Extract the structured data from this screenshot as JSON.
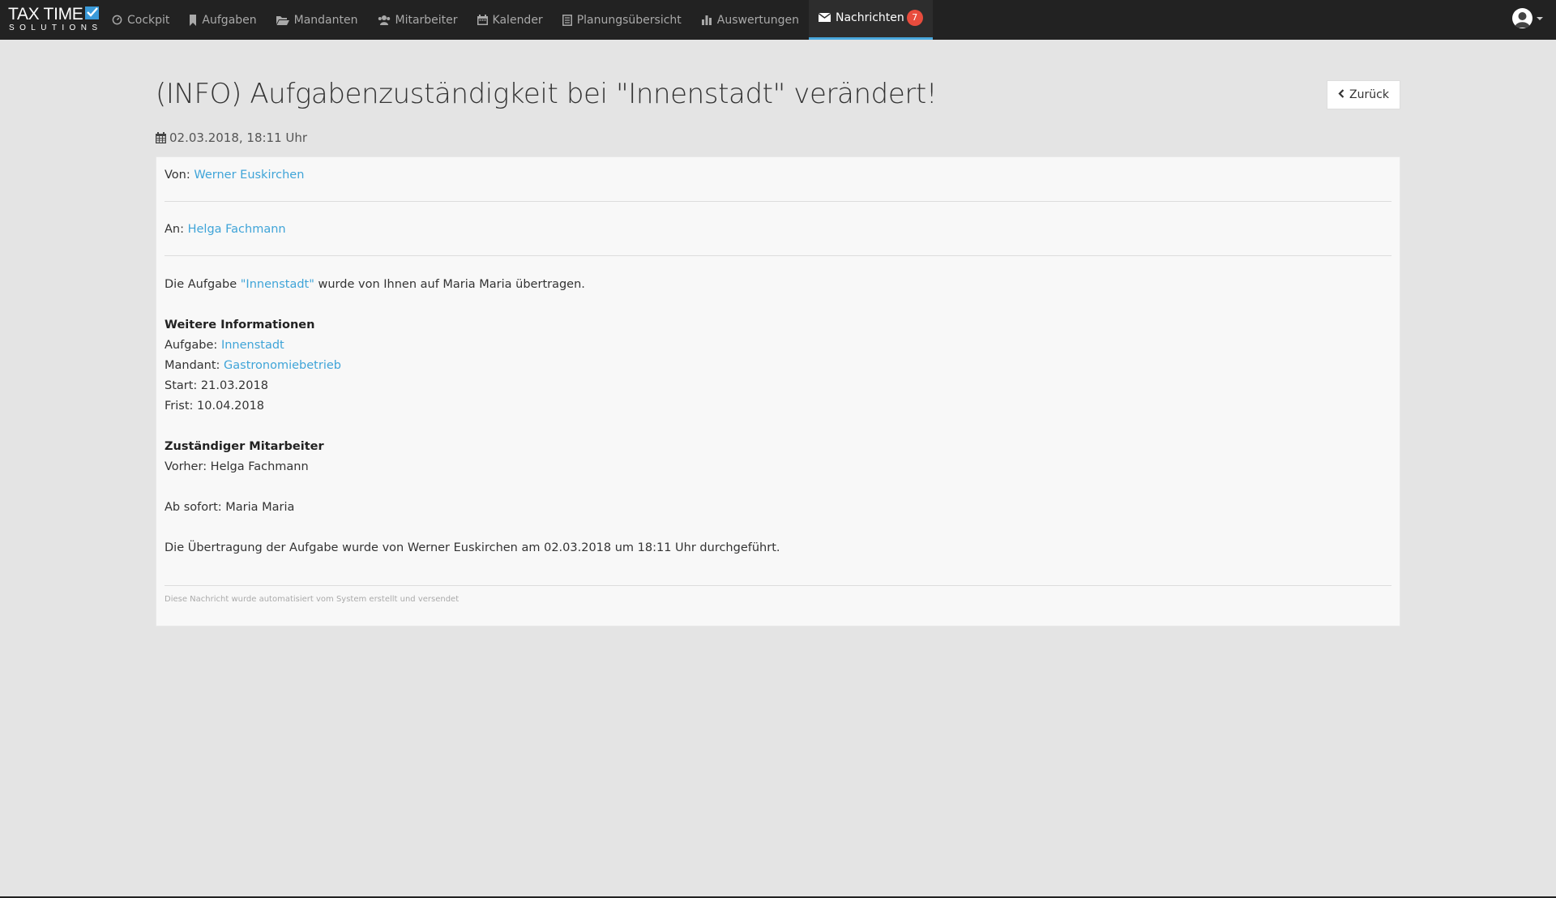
{
  "brand": {
    "line1": "TAX TIME",
    "line2": "SOLUTIONS"
  },
  "nav": [
    {
      "label": "Cockpit",
      "icon": "dashboard-icon"
    },
    {
      "label": "Aufgaben",
      "icon": "bookmark-icon"
    },
    {
      "label": "Mandanten",
      "icon": "folder-open-icon"
    },
    {
      "label": "Mitarbeiter",
      "icon": "users-icon"
    },
    {
      "label": "Kalender",
      "icon": "calendar-icon"
    },
    {
      "label": "Planungsübersicht",
      "icon": "list-icon"
    },
    {
      "label": "Auswertungen",
      "icon": "bar-chart-icon"
    },
    {
      "label": "Nachrichten",
      "icon": "envelope-icon",
      "badge": "7",
      "active": true
    }
  ],
  "page": {
    "title": "(INFO) Aufgabenzuständigkeit bei \"Innenstadt\" verändert!",
    "back_label": "Zurück",
    "datetime": "02.03.2018, 18:11 Uhr"
  },
  "message": {
    "from_label": "Von:",
    "from_name": "Werner Euskirchen",
    "to_label": "An:",
    "to_name": "Helga Fachmann",
    "intro_prefix": "Die Aufgabe ",
    "intro_link": "\"Innenstadt\"",
    "intro_suffix": " wurde von Ihnen auf Maria Maria übertragen.",
    "info_heading": "Weitere Informationen",
    "task_label": "Aufgabe:",
    "task_value": "Innenstadt",
    "client_label": "Mandant:",
    "client_value": "Gastronomiebetrieb",
    "start": "Start: 21.03.2018",
    "deadline": "Frist: 10.04.2018",
    "assignee_heading": "Zuständiger Mitarbeiter",
    "before": "Vorher: Helga Fachmann",
    "from_now": "Ab sofort: Maria Maria",
    "transfer_note": "Die Übertragung der Aufgabe wurde von Werner Euskirchen am 02.03.2018 um 18:11 Uhr durchgeführt.",
    "footnote": "Diese Nachricht wurde automatisiert vom System erstellt und versendet"
  },
  "colors": {
    "navbar": "#222222",
    "accent": "#4aa8dd",
    "badge": "#e84c3d",
    "link": "#3fa4d8"
  }
}
